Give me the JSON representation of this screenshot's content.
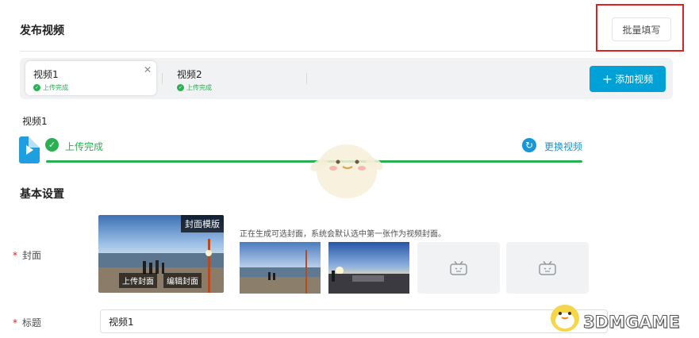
{
  "header": {
    "title": "发布视频",
    "batch_button_label": "批量填写"
  },
  "tabs": [
    {
      "name": "视频1",
      "status": "上传完成",
      "active": true
    },
    {
      "name": "视频2",
      "status": "上传完成",
      "active": false
    }
  ],
  "add_video_label": "添加视频",
  "upload": {
    "filename": "视频1",
    "status": "上传完成",
    "replace_label": "更换视频",
    "progress": 1.0
  },
  "basic_settings": {
    "section_title": "基本设置",
    "cover": {
      "required_mark": "*",
      "label": "封面",
      "badge": "封面模版",
      "upload_label": "上传封面",
      "edit_label": "编辑封面",
      "hint": "正在生成可选封面，系统会默认选中第一张作为视频封面。"
    },
    "title": {
      "required_mark": "*",
      "label": "标题",
      "value": "视频1"
    }
  },
  "watermark": {
    "brand": "3DMGAME",
    "icon": "duck-mascot-icon"
  },
  "colors": {
    "accent": "#00a1d6",
    "success": "#2ab051",
    "highlight": "#e02020"
  }
}
